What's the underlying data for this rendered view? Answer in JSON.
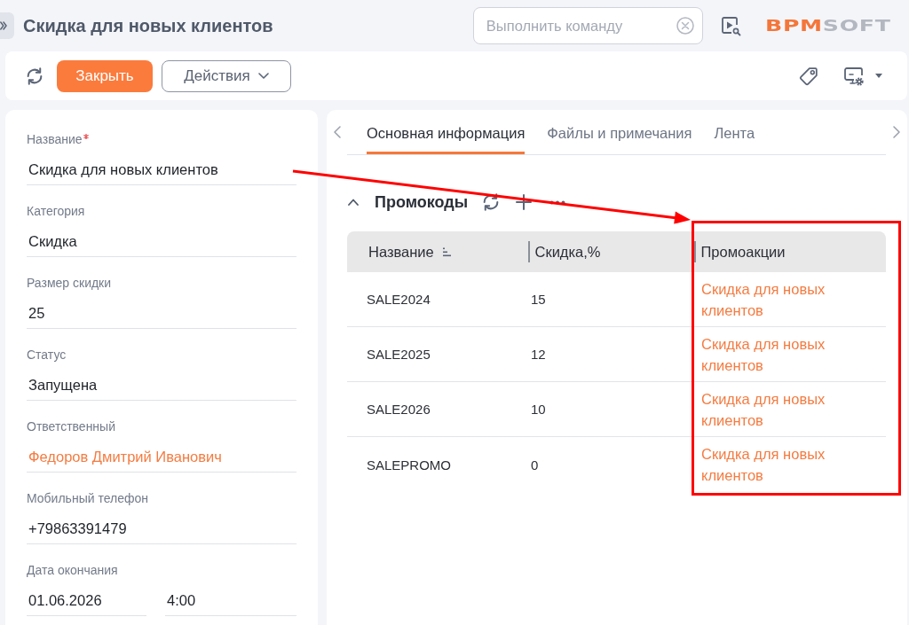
{
  "header": {
    "title": "Скидка для новых клиентов",
    "command_search": {
      "placeholder": "Выполнить команду"
    },
    "logo": {
      "accent": "BPM",
      "rest": "SOFT"
    }
  },
  "toolbar": {
    "buttons": [
      {
        "label": "Закрыть",
        "kind": "primary"
      },
      {
        "label": "Действия",
        "kind": "dropdown"
      }
    ]
  },
  "fields": [
    {
      "label": "Название",
      "required": true,
      "kind": "text",
      "value": "Скидка для новых клиентов"
    },
    {
      "label": "Категория",
      "required": false,
      "kind": "text",
      "value": "Скидка"
    },
    {
      "label": "Размер скидки",
      "required": false,
      "kind": "text",
      "value": "25"
    },
    {
      "label": "Статус",
      "required": false,
      "kind": "text",
      "value": "Запущена"
    },
    {
      "label": "Ответственный",
      "required": false,
      "kind": "link",
      "value": "Федоров Дмитрий Иванович"
    },
    {
      "label": "Мобильный телефон",
      "required": false,
      "kind": "text",
      "value": "+79863391479"
    },
    {
      "label": "Дата окончания",
      "required": false,
      "kind": "datetime",
      "value": "01.06.2026",
      "time": "4:00"
    }
  ],
  "tabs": [
    {
      "label": "Основная информация",
      "selected": true
    },
    {
      "label": "Файлы и примечания",
      "selected": false
    },
    {
      "label": "Лента",
      "selected": false
    }
  ],
  "promo_codes": {
    "title": "Промокоды",
    "expanded": true,
    "table": {
      "columns": [
        {
          "label": "Название",
          "sorted": true
        },
        {
          "label": "Скидка,%",
          "sorted": false
        },
        {
          "label": "Промоакции",
          "sorted": false
        }
      ],
      "rows": [
        {
          "code": "SALE2024",
          "discount": "15",
          "promotion": "Скидка для новых клиентов"
        },
        {
          "code": "SALE2025",
          "discount": "12",
          "promotion": "Скидка для новых клиентов"
        },
        {
          "code": "SALE2026",
          "discount": "10",
          "promotion": "Скидка для новых клиентов"
        },
        {
          "code": "SALEPROMO",
          "discount": "0",
          "promotion": "Скидка для новых клиентов"
        }
      ]
    }
  },
  "annotations": {
    "arrow": true,
    "frame": true
  }
}
